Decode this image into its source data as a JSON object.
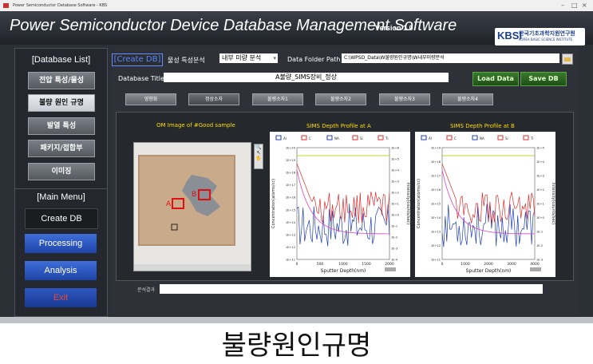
{
  "window": {
    "title": "Power Semiconductor Database Software - KBS"
  },
  "header": {
    "app_title": "Power Semiconductor Device Database Management Software",
    "version": "Version 1.0",
    "logo_kr": "한국기초과학지원연구원",
    "logo_en": "KOREA BASIC SCIENCE INSTITUTE",
    "logo_mark": "KBSI"
  },
  "sidebar": {
    "db_list_title": "[Database List]",
    "db_items": [
      {
        "label": "전압 특성/물성"
      },
      {
        "label": "불량 원인 규명"
      },
      {
        "label": "발열 특성"
      },
      {
        "label": "패키지/접합부"
      },
      {
        "label": "이미징"
      }
    ],
    "main_menu_title": "[Main Menu]",
    "menu_items": [
      {
        "label": "Create DB"
      },
      {
        "label": "Processing"
      },
      {
        "label": "Analysis"
      },
      {
        "label": "Exit"
      }
    ]
  },
  "main": {
    "mode_label": "[Create DB]",
    "analysis_label": "물성 특성분석",
    "analysis_value": "내부 미량 분석",
    "folder_label": "Data Folder Path",
    "folder_value": "C:\\WPSD_Data\\W불량원인규명\\W내부미량분석",
    "db_title_label": "Database Title",
    "db_title_value": "A불량_SIMS장비_정상",
    "load_button": "Load Data",
    "save_button": "Save DB",
    "tabs": [
      {
        "label": "영향화"
      },
      {
        "label": "정상소자"
      },
      {
        "label": "불량소자1"
      },
      {
        "label": "불량소자2"
      },
      {
        "label": "불량소자3"
      },
      {
        "label": "불량소자4"
      }
    ],
    "result_label": "분석결과"
  },
  "om_panel": {
    "title": "OM Image of #Good sample",
    "marker_a": "A",
    "marker_b": "B"
  },
  "caption": "불량원인규명",
  "chart_data": [
    {
      "type": "line",
      "title": "SIMS Depth Profile at A",
      "xlabel": "Sputter Depth(nm)",
      "ylabel": "Concentration(atoms/cc)",
      "y2label": "Intensity(counts/sec)",
      "legend": [
        "Al",
        "C",
        "NA",
        "Si",
        "Ti"
      ],
      "x_ticks": [
        "0",
        "500",
        "1000",
        "1500",
        "2000"
      ],
      "y_ticks": [
        "1E+11",
        "1E+12",
        "1E+13",
        "1E+14",
        "1E+15",
        "1E+16",
        "1E+17",
        "1E+18",
        "1E+19",
        "1E+20"
      ],
      "y2_ticks": [
        "1E-4",
        "1E-3",
        "1E-2",
        "1E-1",
        "1E+0",
        "1E+1",
        "1E+2",
        "1E+3",
        "1E+4",
        "1E+5",
        "1E+6"
      ],
      "xlim": [
        0,
        2000
      ]
    },
    {
      "type": "line",
      "title": "SIMS Depth Profile at B",
      "xlabel": "Sputter Depth(nm)",
      "ylabel": "Concentration(atoms/cc)",
      "y2label": "Intensity(counts/sec)",
      "legend": [
        "Al",
        "C",
        "NA",
        "Si",
        "Ti"
      ],
      "x_ticks": [
        "0",
        "1000",
        "2000",
        "3000",
        "4000"
      ],
      "y_ticks": [
        "1E+11",
        "1E+12",
        "1E+13",
        "1E+14",
        "1E+15",
        "1E+16",
        "1E+17",
        "1E+18",
        "1E+19"
      ],
      "y2_ticks": [
        "1E-3",
        "1E-2",
        "1E-1",
        "1E+0",
        "1E+1",
        "1E+2",
        "1E+3",
        "1E+4",
        "1E+5"
      ],
      "xlim": [
        0,
        4000
      ]
    }
  ]
}
